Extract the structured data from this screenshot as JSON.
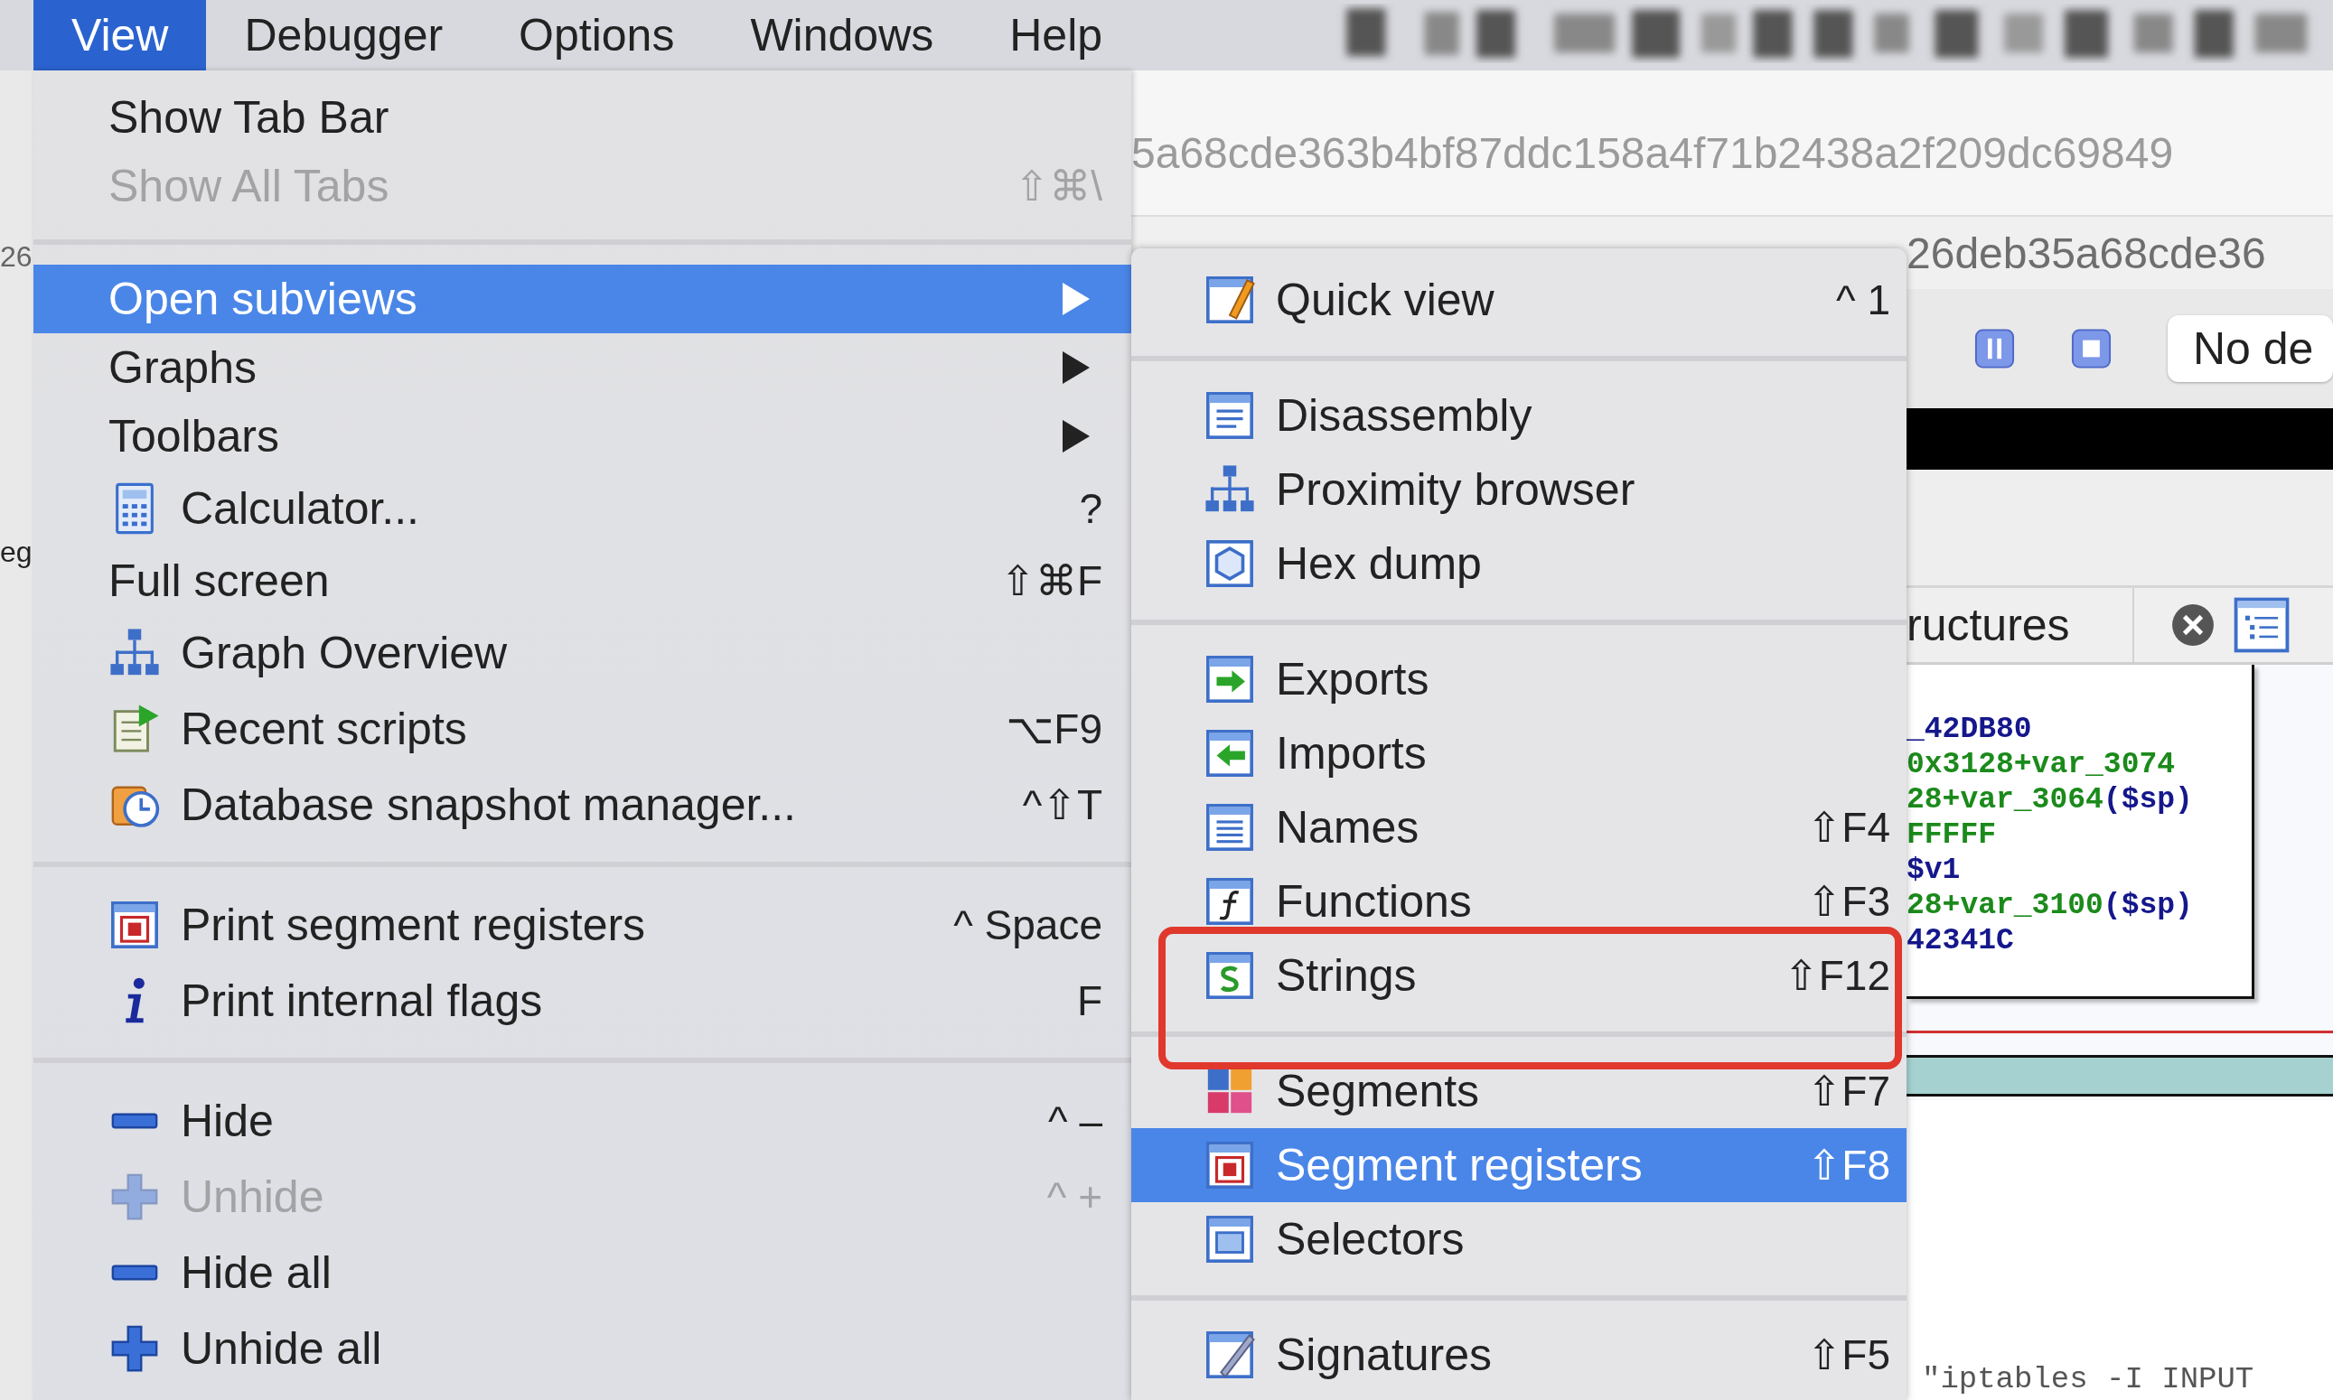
{
  "menubar": [
    {
      "label": "View",
      "selected": true
    },
    {
      "label": "Debugger",
      "selected": false
    },
    {
      "label": "Options",
      "selected": false
    },
    {
      "label": "Windows",
      "selected": false
    },
    {
      "label": "Help",
      "selected": false
    }
  ],
  "background": {
    "left_fragments": [
      "26",
      "eg"
    ],
    "hash_lines": [
      "5a68cde363b4bf87ddc158a4f71b2438a2f209dc69849",
      "26deb35a68cde36"
    ],
    "debug_field": {
      "value": "No de"
    },
    "tab": {
      "label": "ructures"
    },
    "code_lines": [
      {
        "parts": [
          {
            "text": "_42DB80",
            "color": "#15178c"
          }
        ]
      },
      {
        "parts": [
          {
            "text": "0x3128+var_3074",
            "color": "#1b8a1b"
          }
        ]
      },
      {
        "parts": [
          {
            "text": "28+var_3064",
            "color": "#1b8a1b"
          },
          {
            "text": "($sp)",
            "color": "#15178c"
          }
        ]
      },
      {
        "parts": [
          {
            "text": "FFFFF",
            "color": "#1b8a1b"
          }
        ]
      },
      {
        "parts": [
          {
            "text": "$v1",
            "color": "#15178c"
          }
        ]
      },
      {
        "parts": [
          {
            "text": "28+var_3100",
            "color": "#1b8a1b"
          },
          {
            "text": "($sp)",
            "color": "#15178c"
          }
        ]
      },
      {
        "parts": [
          {
            "text": "42341C",
            "color": "#15178c"
          }
        ]
      }
    ],
    "bottom_text": "\"iptables -I INPUT"
  },
  "main_menu": {
    "items": [
      {
        "kind": "item",
        "label": "Show Tab Bar",
        "selected": false,
        "disabled": false,
        "submenu": false
      },
      {
        "kind": "item",
        "label": "Show All Tabs",
        "shortcut": "⇧⌘\\",
        "selected": false,
        "disabled": true,
        "submenu": false
      },
      {
        "kind": "separator"
      },
      {
        "kind": "item",
        "label": "Open subviews",
        "selected": true,
        "disabled": false,
        "submenu": true
      },
      {
        "kind": "item",
        "label": "Graphs",
        "selected": false,
        "disabled": false,
        "submenu": true
      },
      {
        "kind": "item",
        "label": "Toolbars",
        "selected": false,
        "disabled": false,
        "submenu": true
      },
      {
        "kind": "icon-item",
        "label": "Calculator...",
        "shortcut": "?",
        "selected": false,
        "disabled": false,
        "submenu": false
      },
      {
        "kind": "item",
        "label": "Full screen",
        "shortcut": "⇧⌘F",
        "selected": false,
        "disabled": false,
        "submenu": false
      },
      {
        "kind": "icon-item",
        "label": "Graph Overview",
        "selected": false,
        "disabled": false,
        "submenu": false
      },
      {
        "kind": "icon-item",
        "label": "Recent scripts",
        "shortcut": "⌥F9",
        "selected": false,
        "disabled": false,
        "submenu": false
      },
      {
        "kind": "icon-item",
        "label": "Database snapshot manager...",
        "shortcut": "^⇧T",
        "selected": false,
        "disabled": false,
        "submenu": false
      },
      {
        "kind": "separator"
      },
      {
        "kind": "icon-item",
        "label": "Print segment registers",
        "shortcut": "^ Space",
        "selected": false,
        "disabled": false,
        "submenu": false
      },
      {
        "kind": "icon-item",
        "label": "Print internal flags",
        "shortcut": "F",
        "selected": false,
        "disabled": false,
        "submenu": false
      },
      {
        "kind": "separator"
      },
      {
        "kind": "icon-item",
        "label": "Hide",
        "shortcut": "^ –",
        "selected": false,
        "disabled": false,
        "submenu": false
      },
      {
        "kind": "icon-item",
        "label": "Unhide",
        "shortcut": "^ +",
        "selected": false,
        "disabled": true,
        "submenu": false
      },
      {
        "kind": "icon-item",
        "label": "Hide all",
        "selected": false,
        "disabled": false,
        "submenu": false
      },
      {
        "kind": "icon-item",
        "label": "Unhide all",
        "selected": false,
        "disabled": false,
        "submenu": false
      }
    ]
  },
  "submenu": {
    "items": [
      {
        "kind": "icon-item",
        "label": "Quick view",
        "shortcut": "^ 1",
        "selected": false
      },
      {
        "kind": "separator"
      },
      {
        "kind": "icon-item",
        "label": "Disassembly",
        "selected": false
      },
      {
        "kind": "icon-item",
        "label": "Proximity browser",
        "selected": false
      },
      {
        "kind": "icon-item",
        "label": "Hex dump",
        "selected": false
      },
      {
        "kind": "separator"
      },
      {
        "kind": "icon-item",
        "label": "Exports",
        "selected": false
      },
      {
        "kind": "icon-item",
        "label": "Imports",
        "selected": false
      },
      {
        "kind": "icon-item",
        "label": "Names",
        "shortcut": "⇧F4",
        "selected": false
      },
      {
        "kind": "icon-item",
        "label": "Functions",
        "shortcut": "⇧F3",
        "selected": false
      },
      {
        "kind": "icon-item",
        "label": "Strings",
        "shortcut": "⇧F12",
        "selected": false
      },
      {
        "kind": "separator"
      },
      {
        "kind": "icon-item",
        "label": "Segments",
        "shortcut": "⇧F7",
        "selected": false
      },
      {
        "kind": "icon-item",
        "label": "Segment registers",
        "shortcut": "⇧F8",
        "selected": true
      },
      {
        "kind": "icon-item",
        "label": "Selectors",
        "selected": false
      },
      {
        "kind": "separator"
      },
      {
        "kind": "icon-item",
        "label": "Signatures",
        "shortcut": "⇧F5",
        "selected": false
      }
    ]
  }
}
